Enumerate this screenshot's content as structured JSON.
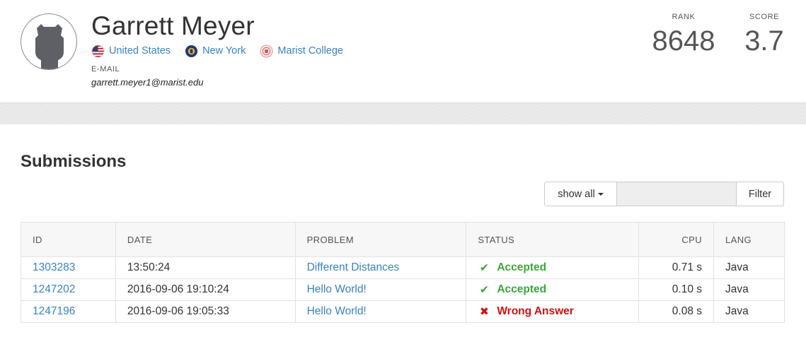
{
  "profile": {
    "name": "Garrett Meyer",
    "country": "United States",
    "region": "New York",
    "school": "Marist College",
    "email_label": "E-MAIL",
    "email": "garrett.meyer1@marist.edu",
    "rank_label": "RANK",
    "rank": "8648",
    "score_label": "SCORE",
    "score": "3.7"
  },
  "submissions": {
    "title": "Submissions",
    "filter_dropdown": "show all",
    "filter_placeholder": "",
    "filter_button": "Filter",
    "columns": [
      "ID",
      "DATE",
      "PROBLEM",
      "STATUS",
      "CPU",
      "LANG"
    ],
    "rows": [
      {
        "id": "1303283",
        "date": "13:50:24",
        "problem": "Different Distances",
        "status": "Accepted",
        "cpu": "0.71 s",
        "lang": "Java"
      },
      {
        "id": "1247202",
        "date": "2016-09-06 19:10:24",
        "problem": "Hello World!",
        "status": "Accepted",
        "cpu": "0.10 s",
        "lang": "Java"
      },
      {
        "id": "1247196",
        "date": "2016-09-06 19:05:33",
        "problem": "Hello World!",
        "status": "Wrong Answer",
        "cpu": "0.08 s",
        "lang": "Java"
      }
    ]
  },
  "colors": {
    "link": "#3a82c4",
    "accepted": "#3aa83a",
    "wrong": "#d01010"
  },
  "icons": {
    "check": "✔",
    "cross": "✖"
  }
}
